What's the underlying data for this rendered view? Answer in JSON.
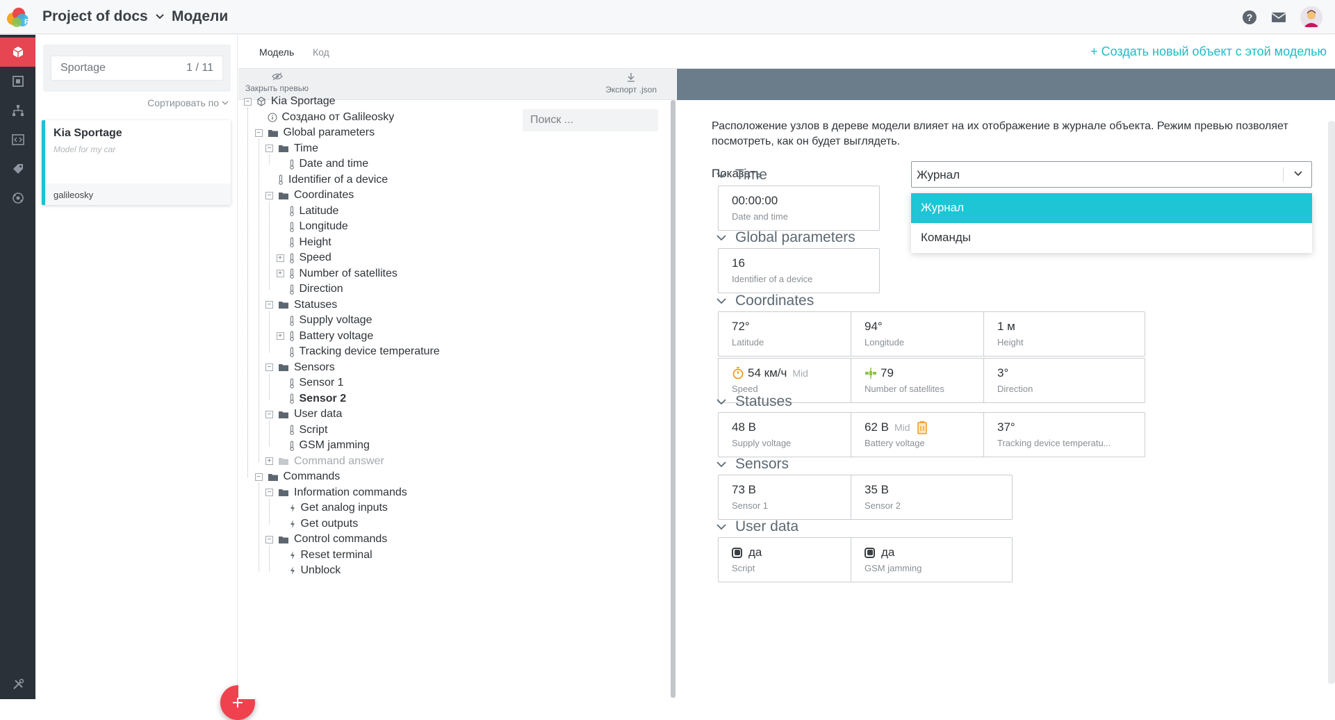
{
  "header": {
    "project": "Project of docs",
    "section": "Модели"
  },
  "sidebar": {
    "search_value": "Sportage",
    "search_count": "1 / 11",
    "sort_label": "Сортировать по",
    "card": {
      "title": "Kia Sportage",
      "description": "Model for my car",
      "footer": "galileosky"
    }
  },
  "tabs": [
    {
      "label": "Модель",
      "active": true
    },
    {
      "label": "Код",
      "active": false
    }
  ],
  "create_link": "+ Создать новый объект с этой моделью",
  "tree_toolbar": {
    "close_preview": "Закрыть превью",
    "export": "Экспорт .json"
  },
  "tree_search_placeholder": "Поиск ...",
  "tree": [
    {
      "label": "Kia Sportage",
      "icon": "cube",
      "toggle": "−"
    },
    {
      "label": "Создано от Galileosky",
      "icon": "info"
    },
    {
      "label": "Global parameters",
      "icon": "folder",
      "toggle": "−"
    },
    {
      "label": "Time",
      "icon": "folder",
      "toggle": "−"
    },
    {
      "label": "Date and time",
      "icon": "thermometer"
    },
    {
      "label": "Identifier of a device",
      "icon": "thermometer"
    },
    {
      "label": "Coordinates",
      "icon": "folder",
      "toggle": "−"
    },
    {
      "label": "Latitude",
      "icon": "thermometer"
    },
    {
      "label": "Longitude",
      "icon": "thermometer"
    },
    {
      "label": "Height",
      "icon": "thermometer"
    },
    {
      "label": "Speed",
      "icon": "thermometer",
      "toggle": "+"
    },
    {
      "label": "Number of satellites",
      "icon": "thermometer",
      "toggle": "+"
    },
    {
      "label": "Direction",
      "icon": "thermometer"
    },
    {
      "label": "Statuses",
      "icon": "folder",
      "toggle": "−"
    },
    {
      "label": "Supply voltage",
      "icon": "thermometer"
    },
    {
      "label": "Battery voltage",
      "icon": "thermometer",
      "toggle": "+"
    },
    {
      "label": "Tracking device temperature",
      "icon": "thermometer"
    },
    {
      "label": "Sensors",
      "icon": "folder",
      "toggle": "−"
    },
    {
      "label": "Sensor 1",
      "icon": "thermometer"
    },
    {
      "label": "Sensor 2",
      "icon": "thermometer",
      "bold": true
    },
    {
      "label": "User data",
      "icon": "folder",
      "toggle": "−"
    },
    {
      "label": "Script",
      "icon": "thermometer"
    },
    {
      "label": "GSM jamming",
      "icon": "thermometer"
    },
    {
      "label": "Command answer",
      "icon": "folder",
      "toggle": "+",
      "disabled": true
    },
    {
      "label": "Commands",
      "icon": "folder",
      "toggle": "−"
    },
    {
      "label": "Information commands",
      "icon": "folder",
      "toggle": "−"
    },
    {
      "label": "Get analog inputs",
      "icon": "lightning"
    },
    {
      "label": "Get outputs",
      "icon": "lightning"
    },
    {
      "label": "Control commands",
      "icon": "folder",
      "toggle": "−"
    },
    {
      "label": "Reset terminal",
      "icon": "lightning"
    },
    {
      "label": "Unblock",
      "icon": "lightning"
    }
  ],
  "preview": {
    "info": "Расположение узлов в дереве модели влияет на их отображение в журнале объекта. Режим превью позволяет посмотреть, как он будет выглядеть.",
    "show_label": "Показать",
    "show_value": "Журнал",
    "options": [
      "Журнал",
      "Команды"
    ],
    "groups": [
      {
        "title": "Time",
        "tiles": [
          {
            "value": "00:00:00",
            "label": "Date and time"
          }
        ]
      },
      {
        "title": "Global parameters",
        "tiles": [
          {
            "value": "16",
            "label": "Identifier of a device"
          }
        ]
      },
      {
        "title": "Coordinates",
        "tiles": [
          {
            "value": "72°",
            "label": "Latitude"
          },
          {
            "value": "94°",
            "label": "Longitude"
          },
          {
            "value": "1 м",
            "label": "Height"
          },
          {
            "value": "54 км/ч",
            "qualifier": "Mid",
            "label": "Speed",
            "icon": "stopwatch"
          },
          {
            "value": "79",
            "label": "Number of satellites",
            "icon": "satellite"
          },
          {
            "value": "3°",
            "label": "Direction"
          }
        ]
      },
      {
        "title": "Statuses",
        "tiles": [
          {
            "value": "48 В",
            "label": "Supply voltage"
          },
          {
            "value": "62 В",
            "qualifier": "Mid",
            "label": "Battery voltage",
            "icon_after": "battery"
          },
          {
            "value": "37°",
            "label": "Tracking device temperatu..."
          }
        ]
      },
      {
        "title": "Sensors",
        "tiles": [
          {
            "value": "73 В",
            "label": "Sensor 1"
          },
          {
            "value": "35 В",
            "label": "Sensor 2"
          }
        ]
      },
      {
        "title": "User data",
        "tiles": [
          {
            "value": "да",
            "label": "Script",
            "check": true
          },
          {
            "value": "да",
            "label": "GSM jamming",
            "check": true
          }
        ]
      }
    ]
  },
  "colors": {
    "accent": "#1cc1d2",
    "danger": "#f0414f",
    "rail": "#2b3138"
  }
}
